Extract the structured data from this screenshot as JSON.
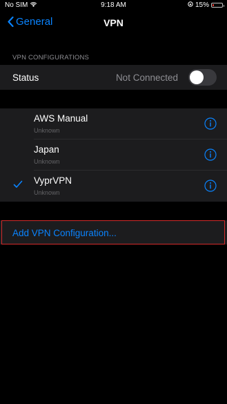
{
  "status_bar": {
    "carrier": "No SIM",
    "time": "9:18 AM",
    "battery": "15%"
  },
  "nav": {
    "back_label": "General",
    "title": "VPN"
  },
  "section_header": "VPN CONFIGURATIONS",
  "status": {
    "label": "Status",
    "value": "Not Connected",
    "toggle_on": false
  },
  "vpn_list": [
    {
      "name": "AWS Manual",
      "subtitle": "Unknown",
      "selected": false
    },
    {
      "name": "Japan",
      "subtitle": "Unknown",
      "selected": false
    },
    {
      "name": "VyprVPN",
      "subtitle": "Unknown",
      "selected": true
    }
  ],
  "add_config": {
    "label": "Add VPN Configuration..."
  },
  "colors": {
    "accent": "#0a84ff",
    "highlight_border": "#d52b2b"
  }
}
